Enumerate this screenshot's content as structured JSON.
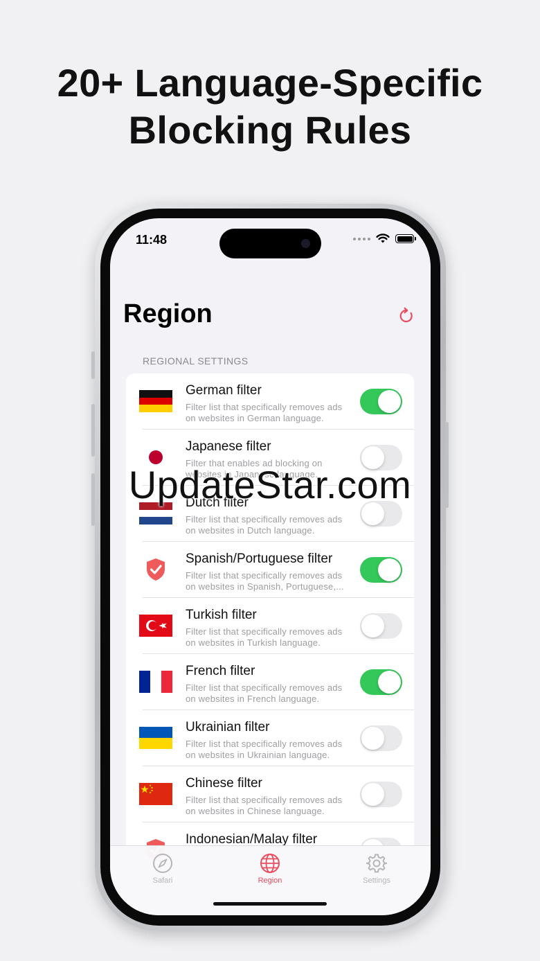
{
  "headline": {
    "line1": "20+ Language-Specific",
    "line2": "Blocking Rules"
  },
  "status_bar": {
    "time": "11:48"
  },
  "page": {
    "title": "Region",
    "section_title": "REGIONAL SETTINGS"
  },
  "filters": [
    {
      "name": "German filter",
      "desc1": "Filter list that specifically removes ads",
      "desc2": "on websites in German language.",
      "enabled": true,
      "flag": "germany-flag"
    },
    {
      "name": "Japanese filter",
      "desc1": "Filter that enables ad blocking on",
      "desc2": "websites in Japanese language.",
      "enabled": false,
      "flag": "japan-flag"
    },
    {
      "name": "Dutch filter",
      "desc1": "Filter list that specifically removes ads",
      "desc2": "on websites in Dutch language.",
      "enabled": false,
      "flag": "netherlands-flag"
    },
    {
      "name": "Spanish/Portuguese filter",
      "desc1": "Filter list that specifically removes ads",
      "desc2": "on websites in Spanish, Portuguese,...",
      "enabled": true,
      "flag": "shield-check-icon"
    },
    {
      "name": "Turkish filter",
      "desc1": "Filter list that specifically removes ads",
      "desc2": "on websites in Turkish language.",
      "enabled": false,
      "flag": "turkey-flag"
    },
    {
      "name": "French filter",
      "desc1": "Filter list that specifically removes ads",
      "desc2": "on websites in French language.",
      "enabled": true,
      "flag": "france-flag"
    },
    {
      "name": "Ukrainian filter",
      "desc1": "Filter list that specifically removes ads",
      "desc2": "on websites in Ukrainian language.",
      "enabled": false,
      "flag": "ukraine-flag"
    },
    {
      "name": "Chinese filter",
      "desc1": "Filter list that specifically removes ads",
      "desc2": "on websites in Chinese language.",
      "enabled": false,
      "flag": "china-flag"
    },
    {
      "name": "Indonesian/Malay filter",
      "desc1": "",
      "desc2": "",
      "enabled": false,
      "flag": "shield-check-icon"
    }
  ],
  "tabs": [
    {
      "label": "Safari",
      "icon": "compass-icon",
      "active": false
    },
    {
      "label": "Region",
      "icon": "globe-icon",
      "active": true
    },
    {
      "label": "Settings",
      "icon": "gear-icon",
      "active": false
    }
  ],
  "watermark": "UpdateStar.com",
  "colors": {
    "accent": "#ea4c5e",
    "toggle_on": "#34c759",
    "toggle_off": "#e9e9eb"
  }
}
